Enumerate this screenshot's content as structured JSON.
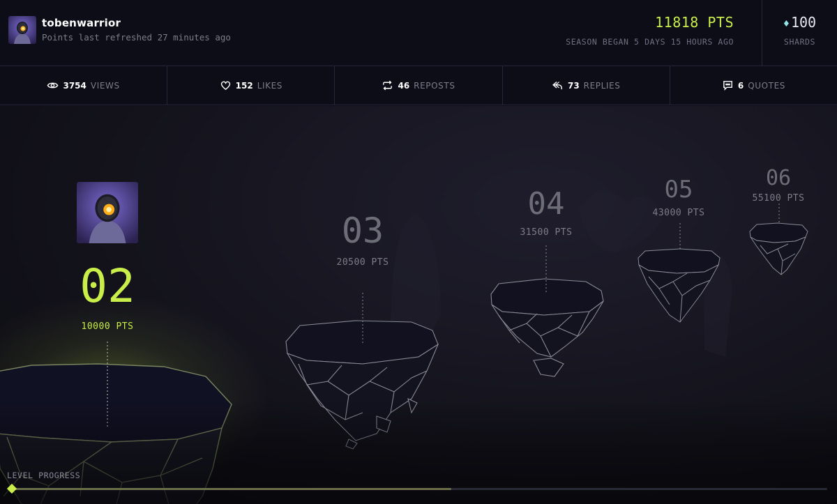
{
  "user": {
    "username": "tobenwarrior",
    "refreshed": "Points last refreshed 27 minutes ago",
    "avatar_icon": "robot-helmet-avatar"
  },
  "points": {
    "total": "11818 PTS",
    "season": "SEASON BEGAN 5 DAYS 15 HOURS AGO"
  },
  "shards": {
    "value": "100",
    "label": "SHARDS",
    "icon": "diamond-icon"
  },
  "stats": [
    {
      "value": "3754",
      "label": "VIEWS",
      "icon": "eye-icon"
    },
    {
      "value": "152",
      "label": "LIKES",
      "icon": "heart-icon"
    },
    {
      "value": "46",
      "label": "REPOSTS",
      "icon": "repost-icon"
    },
    {
      "value": "73",
      "label": "REPLIES",
      "icon": "reply-icon"
    },
    {
      "value": "6",
      "label": "QUOTES",
      "icon": "quote-icon"
    }
  ],
  "levels": [
    {
      "num": "02",
      "pts": "10000 PTS",
      "current": true
    },
    {
      "num": "03",
      "pts": "20500 PTS",
      "current": false
    },
    {
      "num": "04",
      "pts": "31500 PTS",
      "current": false
    },
    {
      "num": "05",
      "pts": "43000 PTS",
      "current": false
    },
    {
      "num": "06",
      "pts": "55100 PTS",
      "current": false
    }
  ],
  "progress": {
    "label": "LEVEL PROGRESS",
    "fraction": 0.54
  },
  "colors": {
    "accent": "#c9ee4a",
    "background": "#0c0c16",
    "muted": "#7d7d8c"
  }
}
